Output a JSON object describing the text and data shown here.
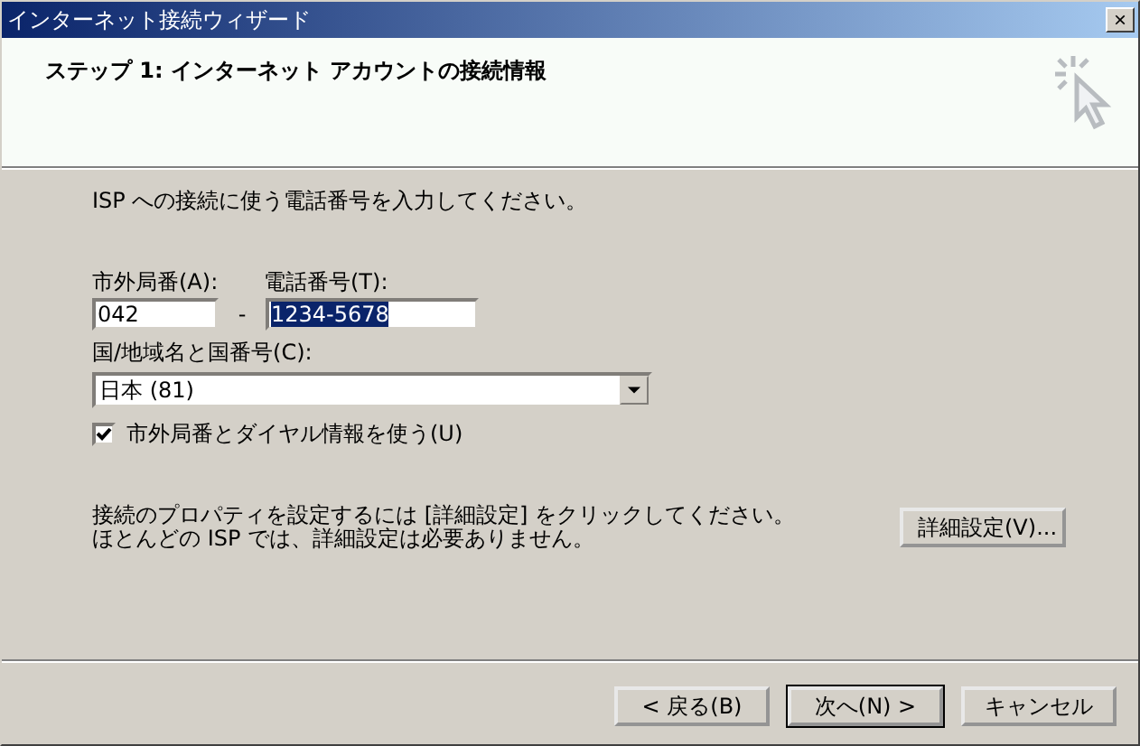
{
  "window": {
    "title": "インターネット接続ウィザード",
    "close": "×"
  },
  "header": {
    "title": "ステップ 1: インターネット アカウントの接続情報"
  },
  "intro": "ISP への接続に使う電話番号を入力してください。",
  "area_code": {
    "label": "市外局番(A):",
    "value": "042"
  },
  "separator": "-",
  "phone": {
    "label": "電話番号(T):",
    "value": "1234-5678",
    "text_selected": true
  },
  "country": {
    "label": "国/地域名と国番号(C):",
    "value": "日本 (81)"
  },
  "dialing_rules": {
    "label": "市外局番とダイヤル情報を使う(U)",
    "checked": true
  },
  "advanced_note": [
    "接続のプロパティを設定するには [詳細設定] をクリックしてください。",
    "ほとんどの ISP では、詳細設定は必要ありません。"
  ],
  "advanced_button": "詳細設定(V)...",
  "buttons": [
    {
      "label": "< 戻る(B)",
      "default": false
    },
    {
      "label": "次へ(N) >",
      "default": true
    },
    {
      "label": "キャンセル",
      "default": false
    }
  ]
}
